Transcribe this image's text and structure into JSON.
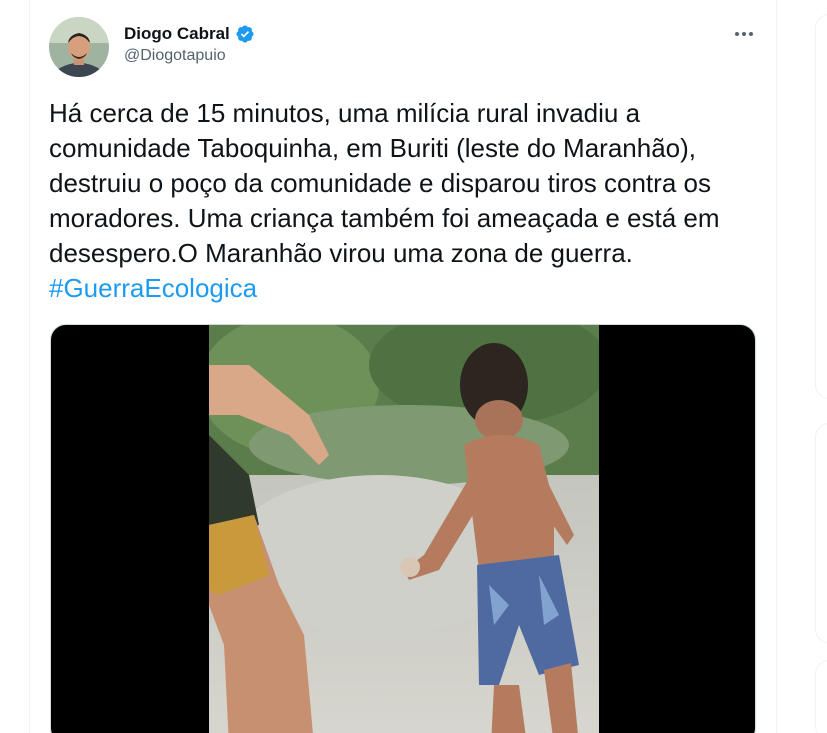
{
  "author": {
    "name": "Diogo Cabral",
    "handle": "@Diogotapuio",
    "verified": true
  },
  "tweet": {
    "text_before_hashtag": "Há cerca de 15 minutos, uma milícia rural invadiu a comunidade Taboquinha, em Buriti (leste do Maranhão), destruiu o poço da comunidade e disparou tiros contra os moradores. Uma criança também foi ameaçada e está em desespero.O Maranhão virou uma zona de guerra. ",
    "hashtag": "#GuerraEcologica"
  },
  "icons": {
    "verified": "verified-badge-icon",
    "more": "more-options-icon"
  },
  "colors": {
    "text": "#0f1419",
    "secondary": "#536471",
    "link": "#1d9bf0",
    "border": "#eff3f4"
  }
}
